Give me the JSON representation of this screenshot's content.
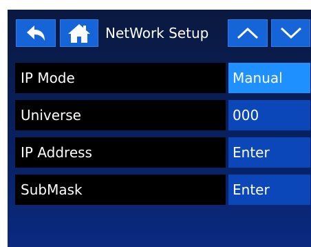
{
  "header": {
    "title": "NetWork Setup",
    "back_icon": "back-arrow-icon",
    "home_icon": "home-icon",
    "up_icon": "chevron-up-icon",
    "down_icon": "chevron-down-icon"
  },
  "rows": [
    {
      "label": "IP Mode",
      "value": "Manual",
      "selected": true
    },
    {
      "label": "Universe",
      "value": "000",
      "selected": false
    },
    {
      "label": "IP Address",
      "value": "Enter",
      "selected": false
    },
    {
      "label": "SubMask",
      "value": "Enter",
      "selected": false
    }
  ],
  "colors": {
    "background": "#082060",
    "button": "#1565d8",
    "value_cell": "#0b47b8",
    "value_selected": "#1e90ff",
    "label_cell": "#000000",
    "text": "#ffffff"
  }
}
